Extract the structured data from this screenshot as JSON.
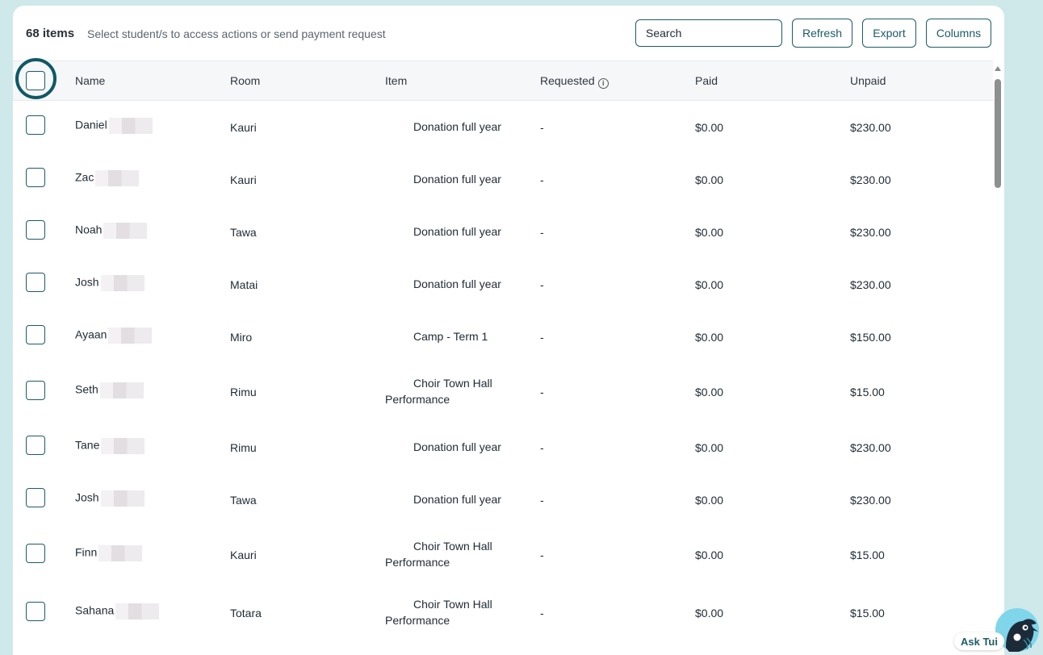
{
  "toolbar": {
    "count": "68 items",
    "hint": "Select student/s to access actions or send payment request",
    "search_placeholder": "Search",
    "refresh_label": "Refresh",
    "export_label": "Export",
    "columns_label": "Columns"
  },
  "columns": {
    "name": "Name",
    "room": "Room",
    "item": "Item",
    "requested": "Requested",
    "requested_info_icon": "info-icon",
    "paid": "Paid",
    "unpaid": "Unpaid"
  },
  "rows": [
    {
      "name": "Daniel",
      "room": "Kauri",
      "item_line1": "Donation full year",
      "item_line2": "",
      "requested": "-",
      "paid": "$0.00",
      "unpaid": "$230.00"
    },
    {
      "name": "Zac",
      "room": "Kauri",
      "item_line1": "Donation full year",
      "item_line2": "",
      "requested": "-",
      "paid": "$0.00",
      "unpaid": "$230.00"
    },
    {
      "name": "Noah",
      "room": "Tawa",
      "item_line1": "Donation full year",
      "item_line2": "",
      "requested": "-",
      "paid": "$0.00",
      "unpaid": "$230.00"
    },
    {
      "name": "Josh",
      "room": "Matai",
      "item_line1": "Donation full year",
      "item_line2": "",
      "requested": "-",
      "paid": "$0.00",
      "unpaid": "$230.00"
    },
    {
      "name": "Ayaan",
      "room": "Miro",
      "item_line1": "Camp - Term 1",
      "item_line2": "",
      "requested": "-",
      "paid": "$0.00",
      "unpaid": "$150.00"
    },
    {
      "name": "Seth",
      "room": "Rimu",
      "item_line1": "Choir Town Hall",
      "item_line2": "Performance",
      "requested": "-",
      "paid": "$0.00",
      "unpaid": "$15.00"
    },
    {
      "name": "Tane",
      "room": "Rimu",
      "item_line1": "Donation full year",
      "item_line2": "",
      "requested": "-",
      "paid": "$0.00",
      "unpaid": "$230.00"
    },
    {
      "name": "Josh",
      "room": "Tawa",
      "item_line1": "Donation full year",
      "item_line2": "",
      "requested": "-",
      "paid": "$0.00",
      "unpaid": "$230.00"
    },
    {
      "name": "Finn",
      "room": "Kauri",
      "item_line1": "Choir Town Hall",
      "item_line2": "Performance",
      "requested": "-",
      "paid": "$0.00",
      "unpaid": "$15.00"
    },
    {
      "name": "Sahana",
      "room": "Totara",
      "item_line1": "Choir Town Hall",
      "item_line2": "Performance",
      "requested": "-",
      "paid": "$0.00",
      "unpaid": "$15.00"
    }
  ],
  "assistant": {
    "label": "Ask Tui",
    "icon": "tui-bird-icon"
  },
  "colors": {
    "accent": "#1d5b66",
    "page_background": "#cfe9ea",
    "header_background": "#f6f7f9"
  }
}
